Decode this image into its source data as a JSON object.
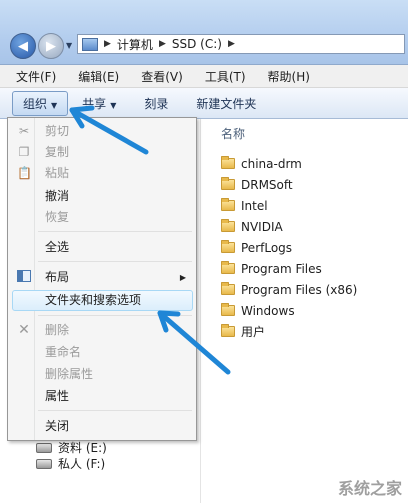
{
  "address": {
    "crumbs": [
      "计算机",
      "SSD (C:)"
    ]
  },
  "menubar": [
    "文件(F)",
    "编辑(E)",
    "查看(V)",
    "工具(T)",
    "帮助(H)"
  ],
  "toolbar": {
    "organize": "组织",
    "share": "共享",
    "burn": "刻录",
    "new_folder": "新建文件夹"
  },
  "column_header": "名称",
  "folders": [
    "china-drm",
    "DRMSoft",
    "Intel",
    "NVIDIA",
    "PerfLogs",
    "Program Files",
    "Program Files (x86)",
    "Windows",
    "用户"
  ],
  "organize_menu": {
    "cut": "剪切",
    "copy": "复制",
    "paste": "粘贴",
    "undo": "撤消",
    "redo": "恢复",
    "select_all": "全选",
    "layout": "布局",
    "folder_options": "文件夹和搜索选项",
    "delete": "删除",
    "rename": "重命名",
    "remove_properties": "删除属性",
    "properties": "属性",
    "close": "关闭"
  },
  "nav_pane": {
    "drive_e": "资料 (E:)",
    "drive_f": "私人 (F:)"
  },
  "watermark": "系统之家",
  "colors": {
    "annotation_arrow": "#1f86d6",
    "highlight": "#dbeefc"
  }
}
